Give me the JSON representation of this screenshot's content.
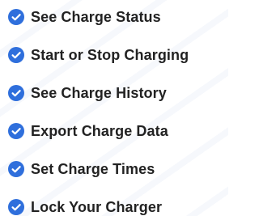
{
  "colors": {
    "accent": "#2f6fdc",
    "text": "#222222",
    "check_mark": "#ffffff"
  },
  "features": [
    {
      "label": "See Charge Status",
      "icon": "check-circle-icon"
    },
    {
      "label": "Start or Stop Charging",
      "icon": "check-circle-icon"
    },
    {
      "label": "See Charge History",
      "icon": "check-circle-icon"
    },
    {
      "label": "Export Charge Data",
      "icon": "check-circle-icon"
    },
    {
      "label": "Set Charge Times",
      "icon": "check-circle-icon"
    },
    {
      "label": "Lock Your Charger",
      "icon": "check-circle-icon"
    }
  ]
}
